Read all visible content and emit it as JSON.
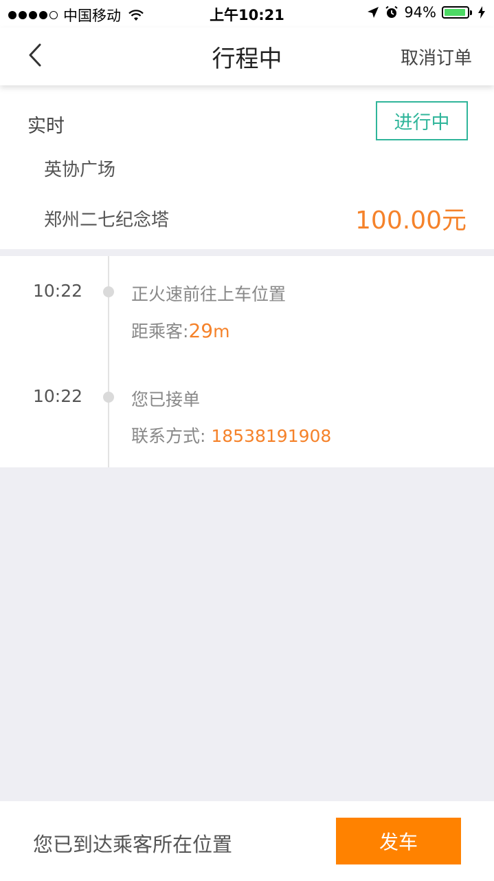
{
  "status_bar": {
    "carrier": "中国移动",
    "time": "上午10:21",
    "battery": "94%",
    "battery_level": 0.94
  },
  "navbar": {
    "title": "行程中",
    "action": "取消订单"
  },
  "order": {
    "type": "实时",
    "status": "进行中",
    "from": "英协广场",
    "to": "郑州二七纪念塔",
    "price": "100.00元"
  },
  "timeline": [
    {
      "time": "10:22",
      "title": "正火速前往上车位置",
      "sub_label": "距乘客:",
      "sub_value": "29",
      "sub_unit": "m"
    },
    {
      "time": "10:22",
      "title": "您已接单",
      "sub_label": "联系方式: ",
      "sub_value": "18538191908"
    }
  ],
  "bottom": {
    "message": "您已到达乘客所在位置",
    "button": "发车"
  },
  "colors": {
    "accent_orange": "#FF8200",
    "status_green": "#2FB59A",
    "price_orange": "#F5822A",
    "background": "#EEEEF3"
  }
}
